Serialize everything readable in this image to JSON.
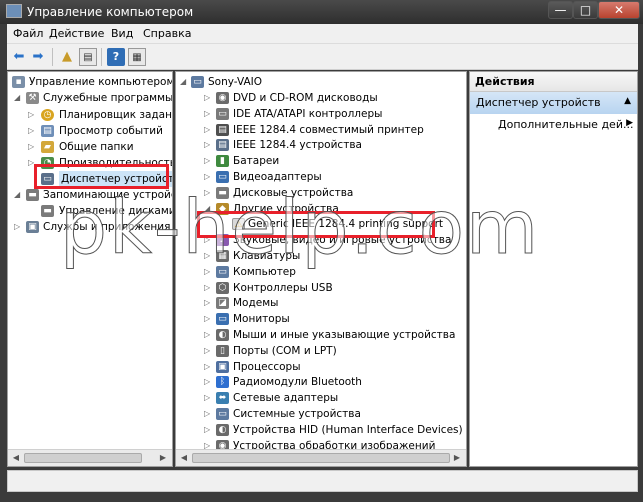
{
  "window": {
    "title": "Управление компьютером",
    "min_label": "—",
    "max_label": "□",
    "close_label": "✕"
  },
  "menu": [
    "Файл",
    "Действие",
    "Вид",
    "Справка"
  ],
  "toolbar": {
    "icons": [
      "back-arrow-icon",
      "forward-arrow-icon",
      "up-folder-icon",
      "show-tree-icon",
      "help-icon",
      "properties-icon"
    ]
  },
  "left_tree": [
    {
      "label": "Управление компьютером (л",
      "icon": "computer-mgmt-icon"
    },
    {
      "label": "Служебные программы",
      "icon": "tools-icon"
    },
    {
      "label": "Планировщик заданий",
      "icon": "scheduler-icon"
    },
    {
      "label": "Просмотр событий",
      "icon": "event-viewer-icon"
    },
    {
      "label": "Общие папки",
      "icon": "shared-folders-icon"
    },
    {
      "label": "Производительность",
      "icon": "performance-icon"
    },
    {
      "label": "Диспетчер устройств",
      "icon": "device-manager-icon"
    },
    {
      "label": "Запоминающие устройст",
      "icon": "storage-icon"
    },
    {
      "label": "Управление дисками",
      "icon": "disk-management-icon"
    },
    {
      "label": "Службы и приложения",
      "icon": "services-icon"
    }
  ],
  "device_tree": {
    "root": "Sony-VAIO",
    "items": [
      "DVD и CD-ROM дисководы",
      "IDE ATA/ATAPI контроллеры",
      "IEEE 1284.4 совместимый принтер",
      "IEEE 1284.4 устройства",
      "Батареи",
      "Видеоадаптеры",
      "Дисковые устройства",
      "Другие устройства",
      "Generic IEEE 1284.4 printing support",
      "Звуковые, видео и игровые устройства",
      "Клавиатуры",
      "Компьютер",
      "Контроллеры USB",
      "Модемы",
      "Мониторы",
      "Мыши и иные указывающие устройства",
      "Порты (COM и LPT)",
      "Процессоры",
      "Радиомодули Bluetooth",
      "Сетевые адаптеры",
      "Системные устройства",
      "Устройства HID (Human Interface Devices)",
      "Устройства обработки изображений"
    ]
  },
  "actions": {
    "header": "Действия",
    "selected": "Диспетчер устройств",
    "more": "Дополнительные дей..."
  },
  "watermark": "pk-help.com",
  "colors": {
    "highlight": "#e8202a",
    "selection": "#cce4f7"
  }
}
